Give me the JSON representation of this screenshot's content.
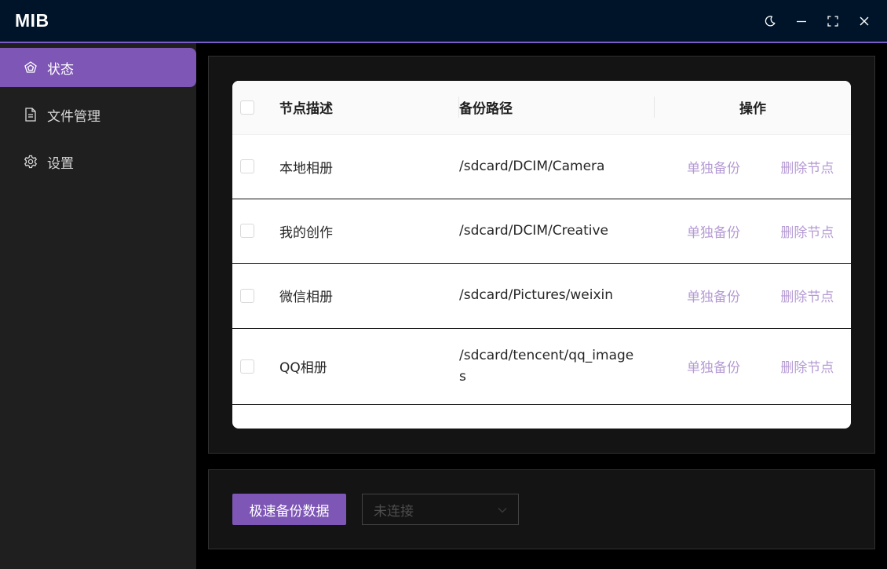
{
  "app": {
    "title": "MIB"
  },
  "window_controls": [
    "moon-icon",
    "minimize-icon",
    "maximize-icon",
    "close-icon"
  ],
  "sidebar": {
    "items": [
      {
        "label": "状态",
        "icon": "status-icon",
        "active": true
      },
      {
        "label": "文件管理",
        "icon": "file-icon",
        "active": false
      },
      {
        "label": "设置",
        "icon": "gear-icon",
        "active": false
      }
    ]
  },
  "table": {
    "columns": {
      "desc": "节点描述",
      "path": "备份路径",
      "ops": "操作"
    },
    "rows": [
      {
        "desc": "本地相册",
        "path": "/sdcard/DCIM/Camera",
        "backup": "单独备份",
        "delete": "删除节点"
      },
      {
        "desc": "我的创作",
        "path": "/sdcard/DCIM/Creative",
        "backup": "单独备份",
        "delete": "删除节点"
      },
      {
        "desc": "微信相册",
        "path": "/sdcard/Pictures/weixin",
        "backup": "单独备份",
        "delete": "删除节点"
      },
      {
        "desc": "QQ相册",
        "path": "/sdcard/tencent/qq_images",
        "backup": "单独备份",
        "delete": "删除节点"
      }
    ]
  },
  "actions": {
    "fast_backup_label": "极速备份数据",
    "device_status": "未连接"
  },
  "colors": {
    "accent": "#7e57b6",
    "titlebar_bg": "#001429",
    "sidebar_bg": "#1f1f1f",
    "link": "#b59bd4"
  }
}
